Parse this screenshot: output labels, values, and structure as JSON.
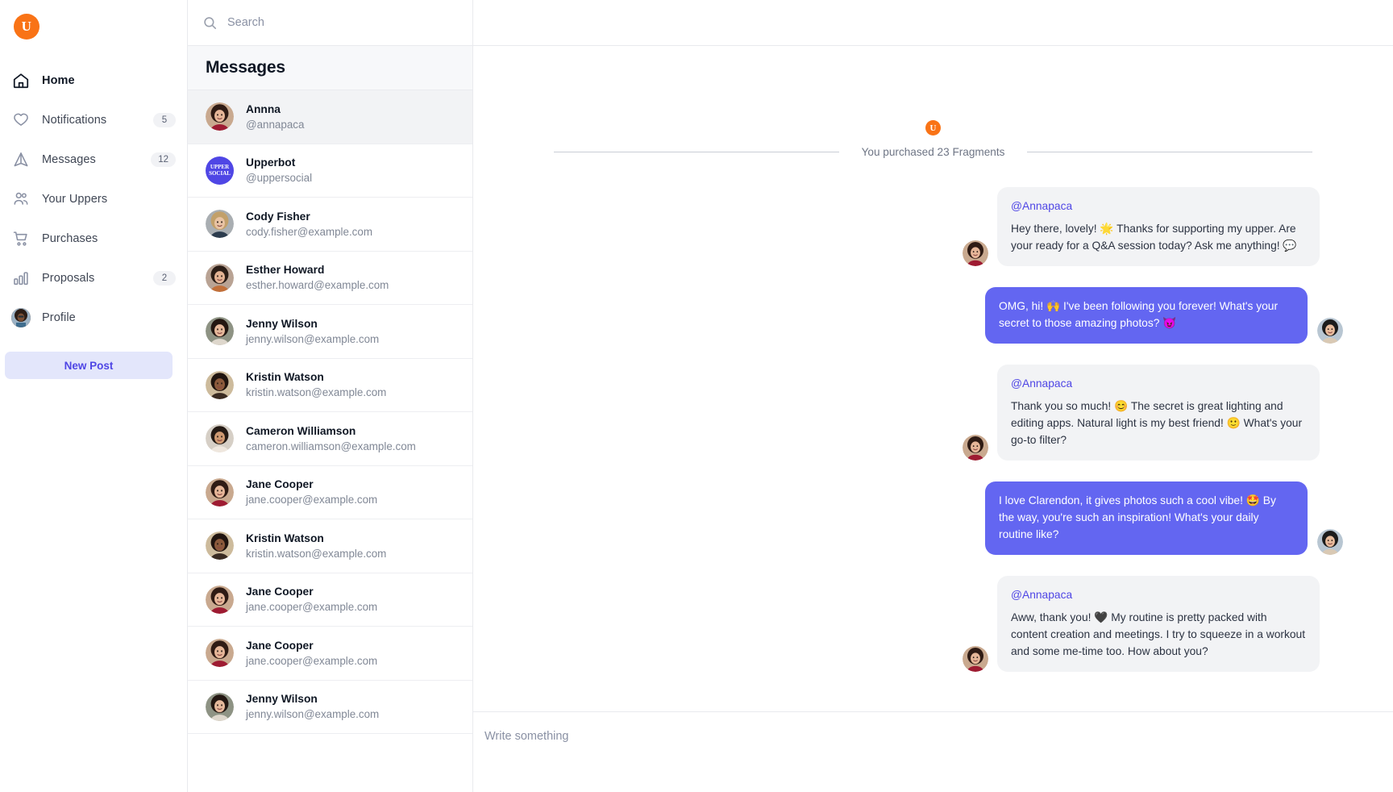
{
  "brand": {
    "logo_letter": "U"
  },
  "sidebar": {
    "items": [
      {
        "label": "Home",
        "icon": "home-icon",
        "badge": null,
        "active": true
      },
      {
        "label": "Notifications",
        "icon": "heart-icon",
        "badge": "5",
        "active": false
      },
      {
        "label": "Messages",
        "icon": "send-icon",
        "badge": "12",
        "active": false
      },
      {
        "label": "Your Uppers",
        "icon": "users-icon",
        "badge": null,
        "active": false
      },
      {
        "label": "Purchases",
        "icon": "shopping-cart-icon",
        "badge": null,
        "active": false
      },
      {
        "label": "Proposals",
        "icon": "bar-chart-icon",
        "badge": "2",
        "active": false
      },
      {
        "label": "Profile",
        "icon": "avatar-icon",
        "badge": null,
        "active": false
      }
    ],
    "new_post_label": "New Post"
  },
  "search": {
    "placeholder": "Search",
    "value": "",
    "icon": "search-icon"
  },
  "messages_panel": {
    "title": "Messages",
    "conversations": [
      {
        "name": "Annna",
        "sub": "@annapaca",
        "avatar": "woman-red-top",
        "selected": true,
        "bot": false
      },
      {
        "name": "Upperbot",
        "sub": "@uppersocial",
        "avatar": "upper-social-bot",
        "selected": false,
        "bot": true,
        "bot_line1": "UPPER",
        "bot_line2": "SOCIAL"
      },
      {
        "name": "Cody Fisher",
        "sub": "cody.fisher@example.com",
        "avatar": "man-blond",
        "selected": false,
        "bot": false
      },
      {
        "name": "Esther Howard",
        "sub": "esther.howard@example.com",
        "avatar": "woman-brown",
        "selected": false,
        "bot": false
      },
      {
        "name": "Jenny Wilson",
        "sub": "jenny.wilson@example.com",
        "avatar": "woman-dark-hair",
        "selected": false,
        "bot": false
      },
      {
        "name": "Kristin Watson",
        "sub": "kristin.watson@example.com",
        "avatar": "woman-beach",
        "selected": false,
        "bot": false
      },
      {
        "name": "Cameron Williamson",
        "sub": "cameron.williamson@example.com",
        "avatar": "man-glasses",
        "selected": false,
        "bot": false
      },
      {
        "name": "Jane Cooper",
        "sub": "jane.cooper@example.com",
        "avatar": "woman-red-top",
        "selected": false,
        "bot": false
      },
      {
        "name": "Kristin Watson",
        "sub": "kristin.watson@example.com",
        "avatar": "woman-beach",
        "selected": false,
        "bot": false
      },
      {
        "name": "Jane Cooper",
        "sub": "jane.cooper@example.com",
        "avatar": "woman-red-top",
        "selected": false,
        "bot": false
      },
      {
        "name": "Jane Cooper",
        "sub": "jane.cooper@example.com",
        "avatar": "woman-red-top",
        "selected": false,
        "bot": false
      },
      {
        "name": "Jenny Wilson",
        "sub": "jenny.wilson@example.com",
        "avatar": "woman-dark-hair",
        "selected": false,
        "bot": false
      }
    ]
  },
  "chat": {
    "system": {
      "logo_letter": "U",
      "text": "You purchased 23 Fragments"
    },
    "bubbles": [
      {
        "side": "left",
        "handle": "@Annapaca",
        "text": "Hey there, lovely! 🌟 Thanks for supporting my upper. Are your ready for a Q&A session today? Ask me anything! 💬",
        "avatar": "woman-red-top"
      },
      {
        "side": "right",
        "handle": null,
        "text": "OMG, hi! 🙌 I've been following you forever! What's your secret to those amazing photos? 😈",
        "avatar": "woman-hat-blonde"
      },
      {
        "side": "left",
        "handle": "@Annapaca",
        "text": "Thank you so much! 😊 The secret is great lighting and editing apps. Natural light is my best friend! 🙂 What's your go-to filter?",
        "avatar": "woman-red-top"
      },
      {
        "side": "right",
        "handle": null,
        "text": "I love Clarendon, it gives photos such a cool vibe! 🤩 By the way, you're such an inspiration! What's your daily routine like?",
        "avatar": "woman-hat-blonde"
      },
      {
        "side": "left",
        "handle": "@Annapaca",
        "text": "Aww, thank you! 🖤 My routine is pretty packed with content creation and meetings. I try to squeeze in a workout and some me-time too. How about you?",
        "avatar": "woman-red-top"
      }
    ],
    "composer": {
      "placeholder": "Write something",
      "value": ""
    }
  },
  "colors": {
    "brand_orange": "#F97316",
    "accent_indigo": "#6366F1",
    "link_indigo": "#4F46E5",
    "bubble_in": "#F2F3F5",
    "newpost_bg": "#E3E6FB",
    "border": "#E9EAEE",
    "text_dark": "#0F1724",
    "text_muted": "#818896"
  }
}
